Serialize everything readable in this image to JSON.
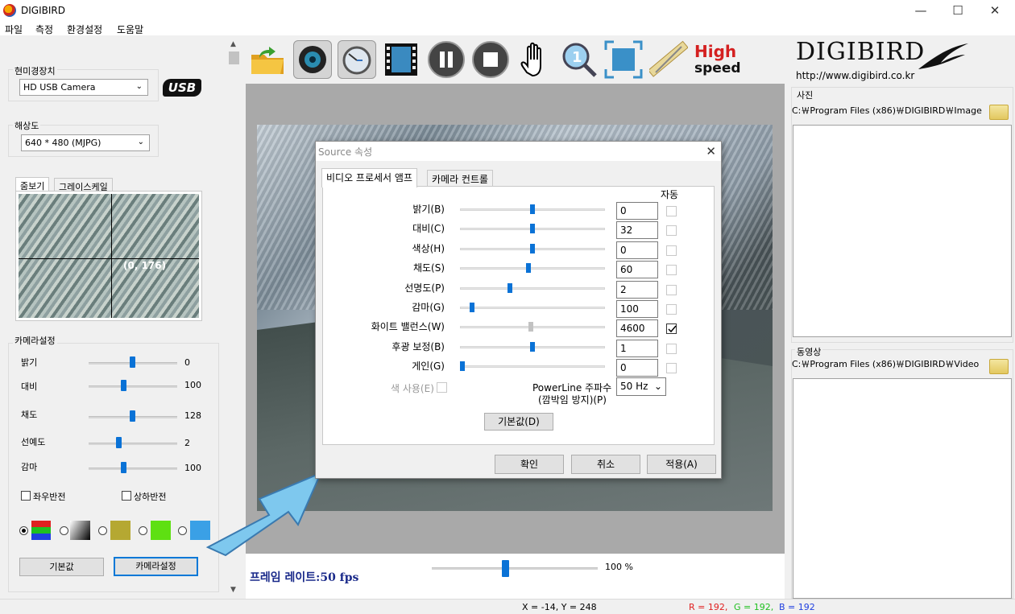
{
  "window": {
    "title": "DIGIBIRD",
    "minimize": "—",
    "maximize": "☐",
    "close": "✕"
  },
  "menu": [
    "파일",
    "측정",
    "환경설정",
    "도움말"
  ],
  "left": {
    "device_group": "현미경장치",
    "device_value": "HD USB Camera",
    "usb_logo": "USB",
    "resolution_group": "해상도",
    "resolution_value": "640 * 480  (MJPG)",
    "tabs": [
      "줌보기",
      "그레이스케일"
    ],
    "zoom_coord": "(0, 176)",
    "camera_group": "카메라설정",
    "sliders": [
      {
        "label": "밝기",
        "value": "0",
        "pos": 0.5
      },
      {
        "label": "대비",
        "value": "100",
        "pos": 0.4
      },
      {
        "label": "채도",
        "value": "128",
        "pos": 0.5
      },
      {
        "label": "선예도",
        "value": "2",
        "pos": 0.33
      },
      {
        "label": "감마",
        "value": "100",
        "pos": 0.4
      }
    ],
    "flip_h": "좌우반전",
    "flip_v": "상하반전",
    "color_options": [
      "#d42020",
      "gradient",
      "#b5a832",
      "#5ee012",
      "#3aa0e6"
    ],
    "default_button": "기본값",
    "camera_settings_button": "카메라설정"
  },
  "toolbar": {
    "icons": [
      "open-folder-icon",
      "camera-lens-icon",
      "timer-icon",
      "film-strip-icon",
      "pause-icon",
      "stop-icon",
      "hand-icon",
      "magnifier-icon",
      "fullscreen-icon",
      "ruler-icon"
    ],
    "high_speed_line1": "High",
    "high_speed_line2": "speed"
  },
  "view": {
    "fps_label": "프레임 레이트:50 fps",
    "zoom_percent": "100 %",
    "zoom_pos": 0.43
  },
  "dialog": {
    "title": "Source 속성",
    "close": "✕",
    "tabs": [
      "비디오 프로세서 앰프",
      "카메라 컨트롤"
    ],
    "auto_header": "자동",
    "rows": [
      {
        "label": "밝기(B)",
        "value": "0",
        "pos": 0.5,
        "auto": false,
        "disabled": false
      },
      {
        "label": "대비(C)",
        "value": "32",
        "pos": 0.5,
        "auto": false,
        "disabled": false
      },
      {
        "label": "색상(H)",
        "value": "0",
        "pos": 0.5,
        "auto": false,
        "disabled": false
      },
      {
        "label": "채도(S)",
        "value": "60",
        "pos": 0.47,
        "auto": false,
        "disabled": false
      },
      {
        "label": "선명도(P)",
        "value": "2",
        "pos": 0.34,
        "auto": false,
        "disabled": false
      },
      {
        "label": "감마(G)",
        "value": "100",
        "pos": 0.07,
        "auto": false,
        "disabled": false
      },
      {
        "label": "화이트 밸런스(W)",
        "value": "4600",
        "pos": 0.49,
        "auto": true,
        "disabled": true
      },
      {
        "label": "후광 보정(B)",
        "value": "1",
        "pos": 0.5,
        "auto": false,
        "disabled": false
      },
      {
        "label": "게인(G)",
        "value": "0",
        "pos": 0.0,
        "auto": false,
        "disabled": false
      }
    ],
    "color_enable": "색 사용(E)",
    "powerline_label1": "PowerLine 주파수",
    "powerline_label2": "(깜박임 방지)(P)",
    "powerline_value": "50 Hz",
    "default_button": "기본값(D)",
    "ok_button": "확인",
    "cancel_button": "취소",
    "apply_button": "적용(A)"
  },
  "right": {
    "logo": "DIGIBIRD",
    "url": "http://www.digibird.co.kr",
    "photo_group": "사진",
    "photo_path": "C:￦Program Files (x86)￦DIGIBIRD￦Image",
    "video_group": "동영상",
    "video_path": "C:￦Program Files (x86)￦DIGIBIRD￦Video"
  },
  "status": {
    "coords": "X = -14, Y = 248",
    "r": "R = 192,",
    "g": "G = 192,",
    "b": "B = 192",
    "colors": {
      "r": "#e02020",
      "g": "#20c020",
      "b": "#2040e0"
    }
  }
}
